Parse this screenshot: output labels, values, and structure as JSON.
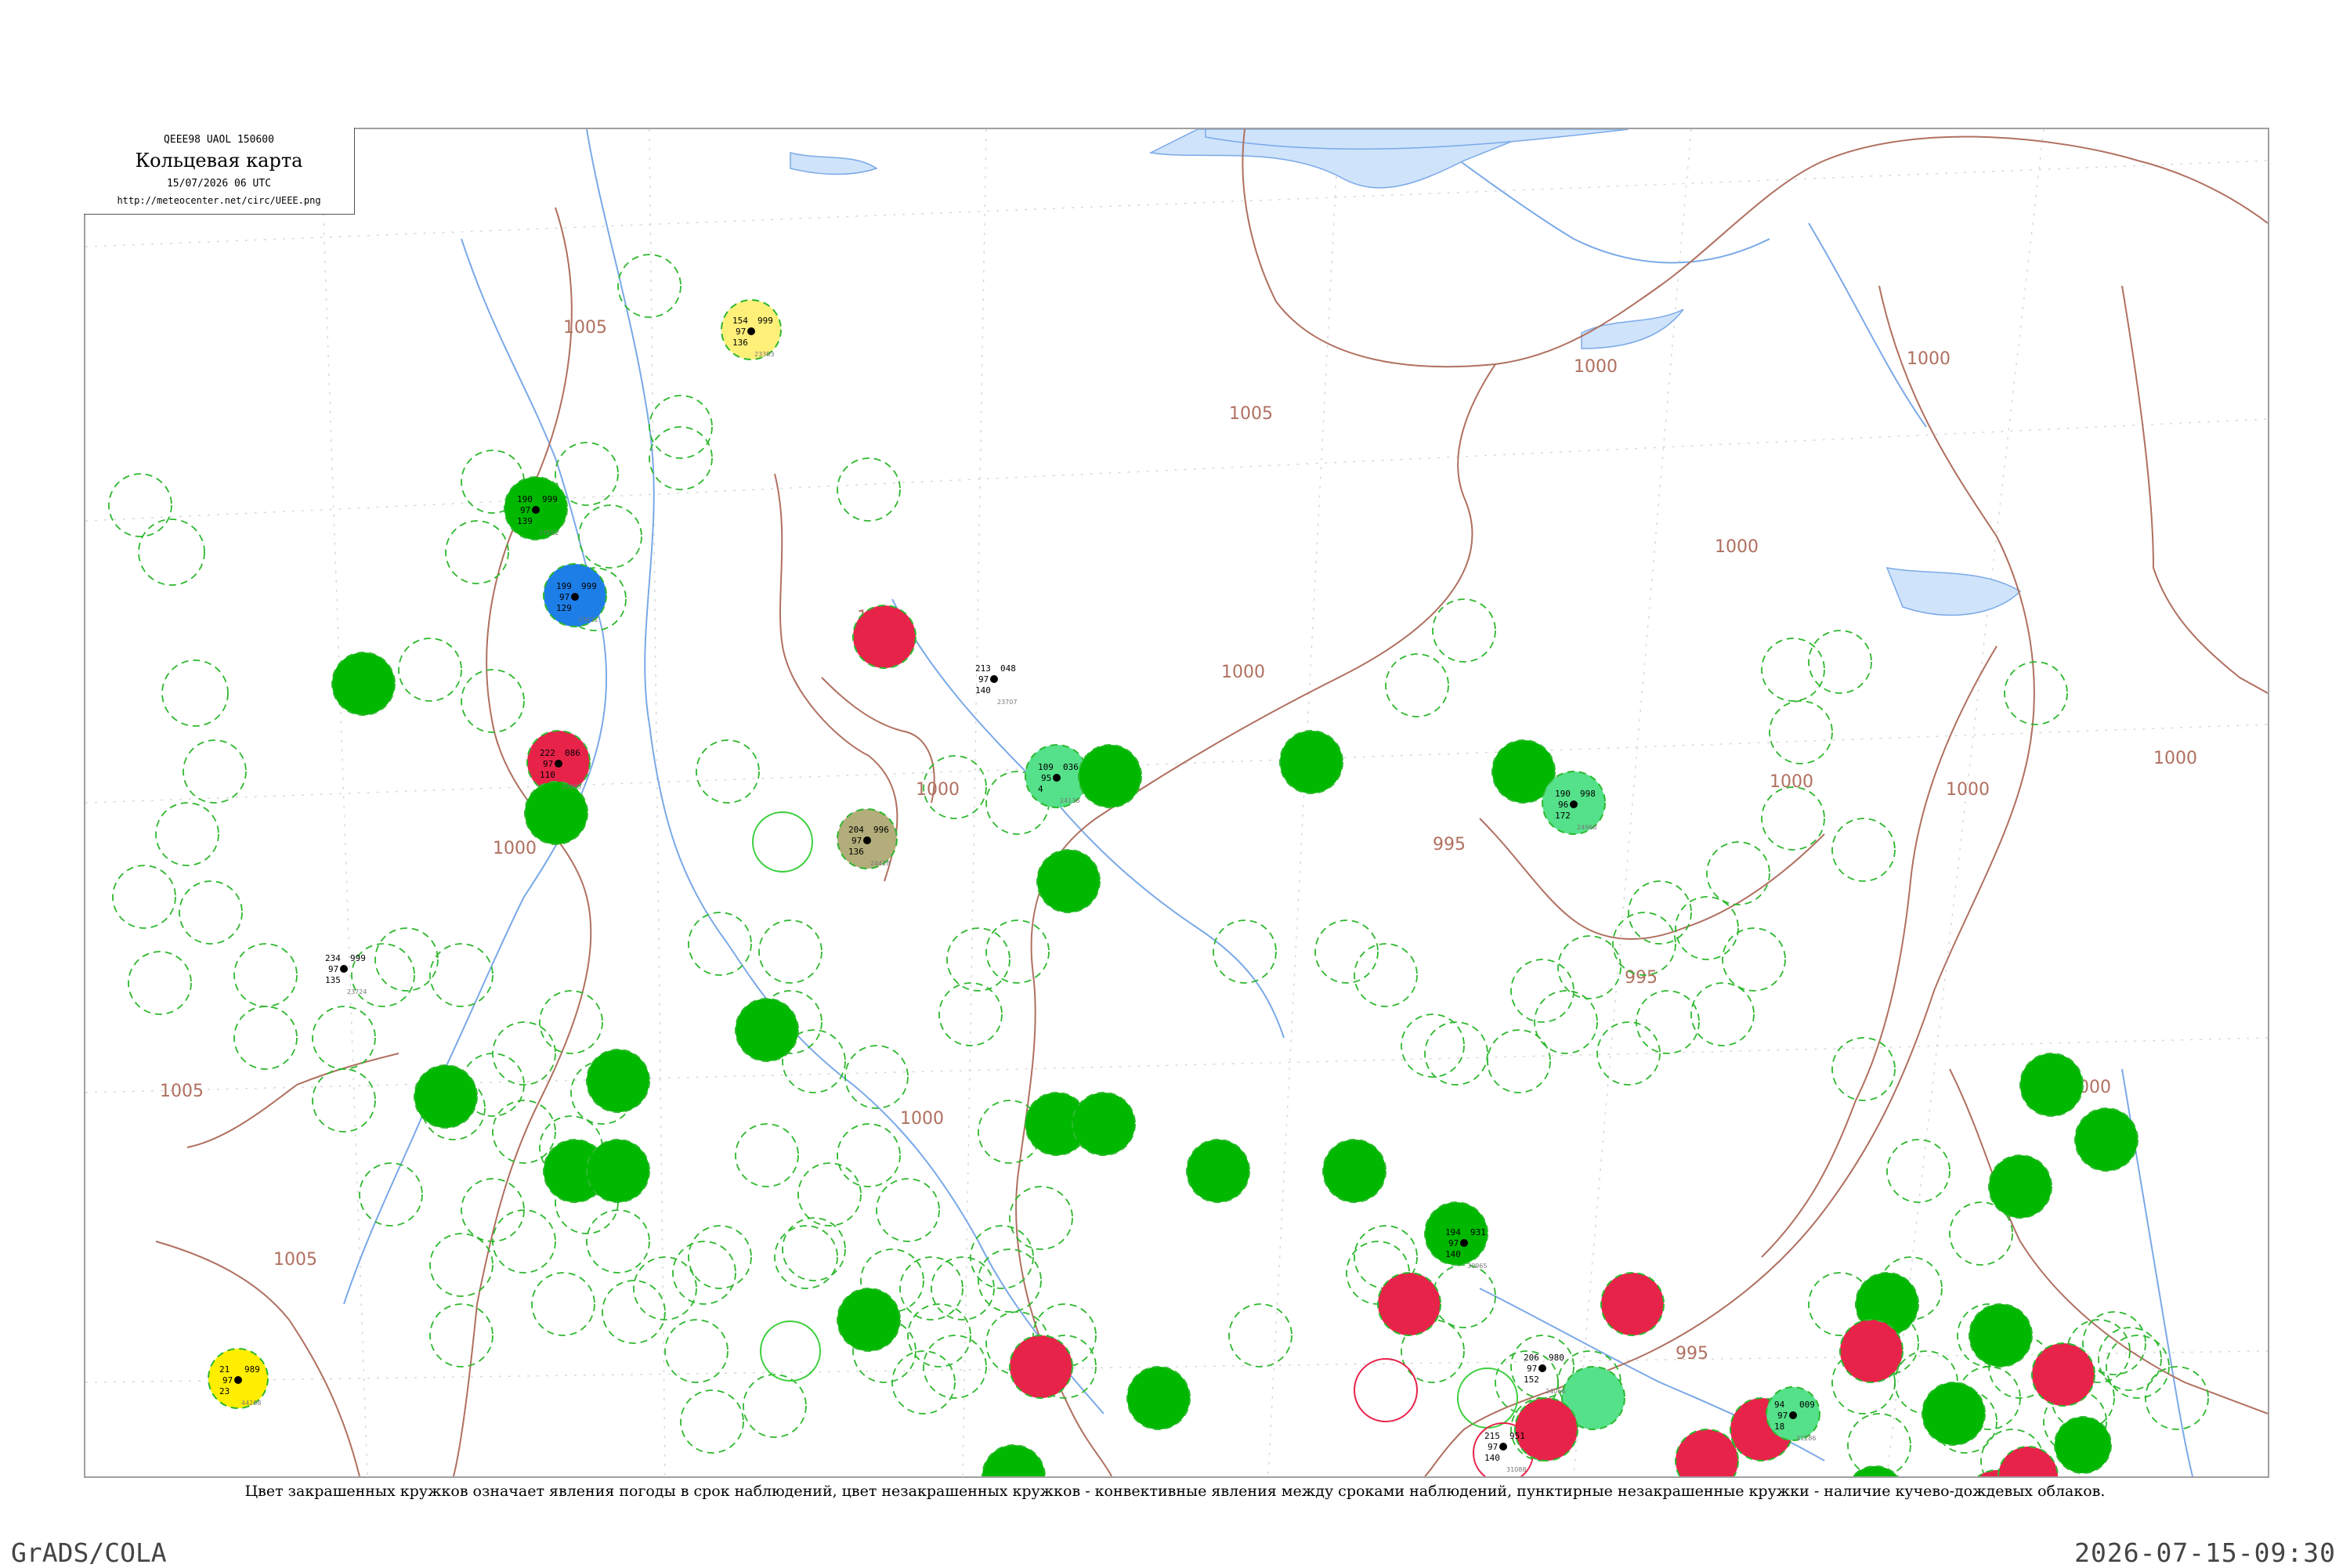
{
  "header": {
    "code": "QEEE98  UAOL  150600",
    "title": "Кольцевая карта",
    "datetime": "15/07/2026 06 UTC",
    "url": "http://meteocenter.net/circ/UEEE.png"
  },
  "caption": "Цвет закрашенных кружков означает явления погоды в срок наблюдений, цвет незакрашенных кружков - конвективные явления между сроками наблюдений, пунктирные незакрашенные кружки - наличие кучево-дождевых облаков.",
  "footer": {
    "software": "GrADS/COLA",
    "timestamp": "2026-07-15-09:30"
  },
  "colors": {
    "isobar": "#b07060",
    "river": "#7aa9e8",
    "dashed_ring": "#2eb82e",
    "rain": "#00b800",
    "shower_light": "#55e08a",
    "thunder": "#e8234a",
    "snow_blue": "#1e7ee8",
    "fog_olive": "#b2ad7a",
    "haze_yellow": "#fff07a",
    "dust_yellow": "#ffee00"
  },
  "isobar_labels": [
    "1005",
    "1005",
    "1005",
    "1000",
    "1000",
    "1000",
    "1000",
    "1000",
    "1000",
    "995",
    "995",
    "995",
    "1000",
    "1000",
    "1005",
    "1000",
    "1000",
    "1000",
    "1000",
    "1000"
  ],
  "stations": [
    {
      "t": "154",
      "p": "999",
      "v": "97",
      "d": "136",
      "id": "23383",
      "state": "haze"
    },
    {
      "t": "199",
      "p": "999",
      "v": "97",
      "d": "129",
      "id": "23631",
      "state": "snow"
    },
    {
      "t": "190",
      "p": "999",
      "v": "97",
      "d": "139",
      "id": "23552",
      "state": "rain"
    },
    {
      "t": "234",
      "p": "999",
      "v": "97",
      "d": "135",
      "id": "23724",
      "state": "ring"
    },
    {
      "t": "213",
      "p": "048",
      "v": "97",
      "d": "140",
      "id": "23707",
      "state": "ring"
    },
    {
      "t": "222",
      "p": "086",
      "v": "97",
      "d": "110",
      "id": "23933",
      "state": "thunder"
    },
    {
      "t": "206",
      "p": "980",
      "v": "97",
      "d": "152",
      "id": "24066",
      "state": "thunder"
    },
    {
      "t": "204",
      "p": "996",
      "v": "97",
      "d": "136",
      "id": "24418",
      "state": "fog"
    },
    {
      "t": "109",
      "p": "036",
      "v": "95",
      "d": "4",
      "id": "24136",
      "state": "shower"
    },
    {
      "t": "190",
      "p": "998",
      "v": "96",
      "d": "172",
      "id": "24966",
      "state": "shower"
    },
    {
      "t": "94",
      "p": "009",
      "v": "97",
      "d": "18",
      "id": "31286",
      "state": "shower"
    },
    {
      "t": "215",
      "p": "951",
      "v": "97",
      "d": "140",
      "id": "31088",
      "state": "thunder"
    },
    {
      "t": "21",
      "p": "989",
      "v": "97",
      "d": "23",
      "id": "44288",
      "state": "dust"
    },
    {
      "t": "194",
      "p": "931",
      "v": "97",
      "d": "140",
      "id": "30965",
      "state": "ring"
    }
  ]
}
